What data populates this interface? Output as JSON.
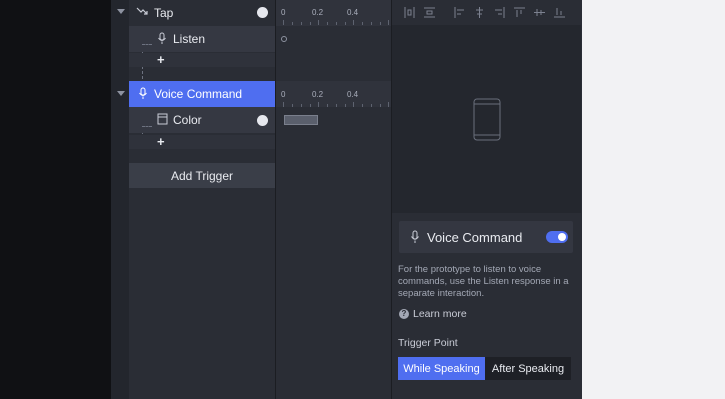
{
  "tree": {
    "tap": {
      "label": "Tap"
    },
    "listen": {
      "label": "Listen"
    },
    "add_symbol": "+",
    "voice_command": {
      "label": "Voice Command"
    },
    "color": {
      "label": "Color"
    },
    "add_trigger": "Add Trigger"
  },
  "ruler": {
    "ticks": [
      "0",
      "0.2",
      "0.4"
    ]
  },
  "inspector": {
    "title": "Voice Command",
    "toggle_on": true,
    "description": "For the prototype to listen to voice commands, use the Listen response in a separate interaction.",
    "learn_more": "Learn more",
    "help_symbol": "?",
    "trigger_point_label": "Trigger Point",
    "trigger_options": [
      "While Speaking",
      "After Speaking"
    ],
    "selected_option": "While Speaking"
  },
  "colors": {
    "accent": "#4f6ef0",
    "background": "#2a2d35",
    "row": "#353842"
  },
  "icons": {
    "tap": "tap-gesture-icon",
    "listen": "microphone-icon",
    "voice_command": "microphone-icon",
    "color": "color-layer-icon",
    "device": "phone-outline-icon"
  }
}
